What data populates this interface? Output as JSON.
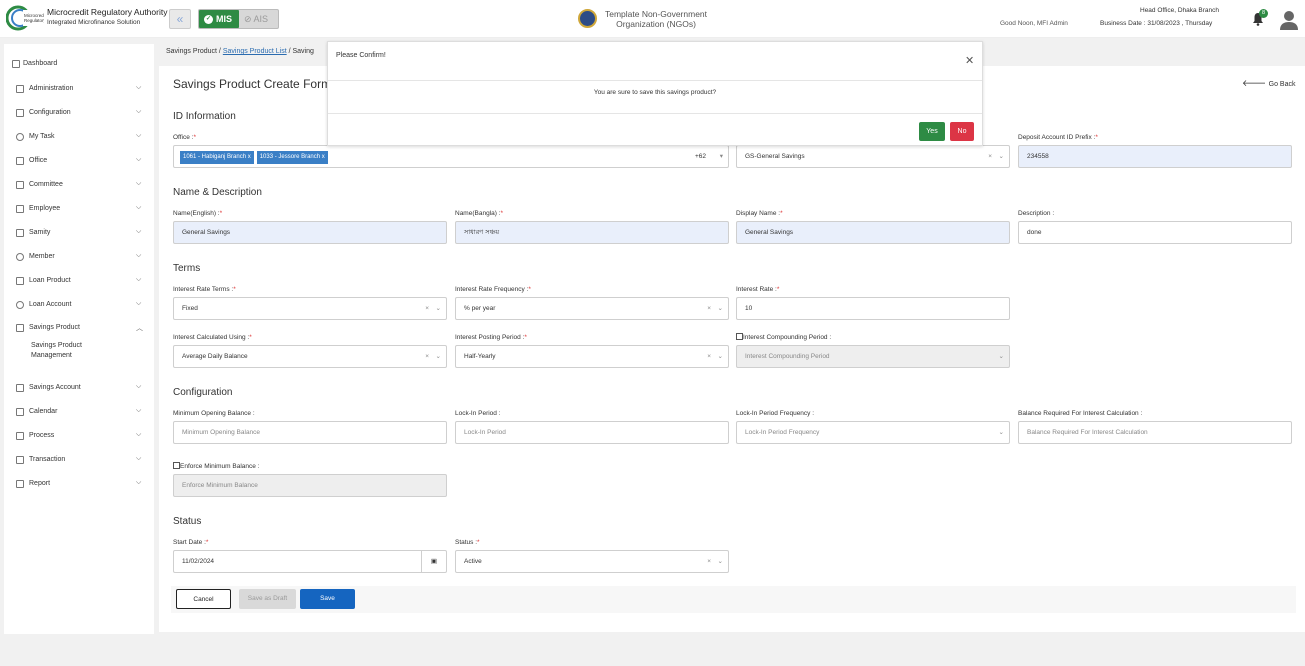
{
  "header": {
    "brand_name": "Microcredit Regulatory Authority",
    "brand_sub": "Integrated Microfinance Solution",
    "mis_label": "MIS",
    "ais_label": "AIS",
    "org_name": "Template Non-Government Organization (NGOs)",
    "greeting": "Good Noon, MFI Admin",
    "branch": "Head Office, Dhaka Branch",
    "business_date": "Business Date : 31/08/2023 , Thursday",
    "notification_count": "8"
  },
  "sidebar": {
    "items": [
      {
        "label": "Dashboard"
      },
      {
        "label": "Administration"
      },
      {
        "label": "Configuration"
      },
      {
        "label": "My Task"
      },
      {
        "label": "Office"
      },
      {
        "label": "Committee"
      },
      {
        "label": "Employee"
      },
      {
        "label": "Samity"
      },
      {
        "label": "Member"
      },
      {
        "label": "Loan Product"
      },
      {
        "label": "Loan Account"
      },
      {
        "label": "Savings Product"
      },
      {
        "label": "Savings Account"
      },
      {
        "label": "Calendar"
      },
      {
        "label": "Process"
      },
      {
        "label": "Transaction"
      },
      {
        "label": "Report"
      }
    ],
    "sub_item": "Savings Product Management"
  },
  "breadcrumb": {
    "root": "Savings Product",
    "link": "Savings Product List",
    "current": "Saving"
  },
  "page": {
    "title": "Savings Product Create Form",
    "go_back": "Go Back"
  },
  "sections": {
    "id_info": "ID Information",
    "name_desc": "Name & Description",
    "terms": "Terms",
    "configuration": "Configuration",
    "status": "Status"
  },
  "fields": {
    "office": {
      "label": "Office :",
      "tags": [
        "1061 - Habiganj Branch x",
        "1033 - Jessore Branch x"
      ],
      "more": "+62"
    },
    "product_type": {
      "value": "GS-General Savings"
    },
    "deposit_prefix": {
      "label": "Deposit Account ID Prefix :",
      "value": "234558"
    },
    "name_en": {
      "label": "Name(English) :",
      "value": "General Savings"
    },
    "name_bn": {
      "label": "Name(Bangla) :",
      "value": "সাধারণ সঞ্চয়"
    },
    "display_name": {
      "label": "Display Name :",
      "value": "General Savings"
    },
    "description": {
      "label": "Description :",
      "value": "done"
    },
    "rate_terms": {
      "label": "Interest Rate Terms :",
      "value": "Fixed"
    },
    "rate_freq": {
      "label": "Interest Rate Frequency :",
      "value": "% per year"
    },
    "rate": {
      "label": "Interest Rate :",
      "value": "10"
    },
    "calc_using": {
      "label": "Interest Calculated Using :",
      "value": "Average Daily Balance"
    },
    "posting_period": {
      "label": "Interest Posting Period :",
      "value": "Half-Yearly"
    },
    "compounding": {
      "label": "Interest Compounding Period :",
      "placeholder": "Interest Compounding Period"
    },
    "min_open": {
      "label": "Minimum Opening Balance :",
      "placeholder": "Minimum Opening Balance"
    },
    "lockin": {
      "label": "Lock-In Period :",
      "placeholder": "Lock-In Period"
    },
    "lockin_freq": {
      "label": "Lock-In Period Frequency :",
      "placeholder": "Lock-In Period Frequency"
    },
    "bal_req": {
      "label": "Balance Required For Interest Calculation :",
      "placeholder": "Balance Required For Interest Calculation"
    },
    "enforce_min": {
      "label": "Enforce Minimum Balance :",
      "placeholder": "Enforce Minimum Balance"
    },
    "start_date": {
      "label": "Start Date :",
      "value": "11/02/2024"
    },
    "status": {
      "label": "Status :",
      "value": "Active"
    }
  },
  "buttons": {
    "cancel": "Cancel",
    "draft": "Save as Draft",
    "save": "Save"
  },
  "modal": {
    "title": "Please Confirm!",
    "body": "You are sure to save this savings product?",
    "yes": "Yes",
    "no": "No"
  }
}
